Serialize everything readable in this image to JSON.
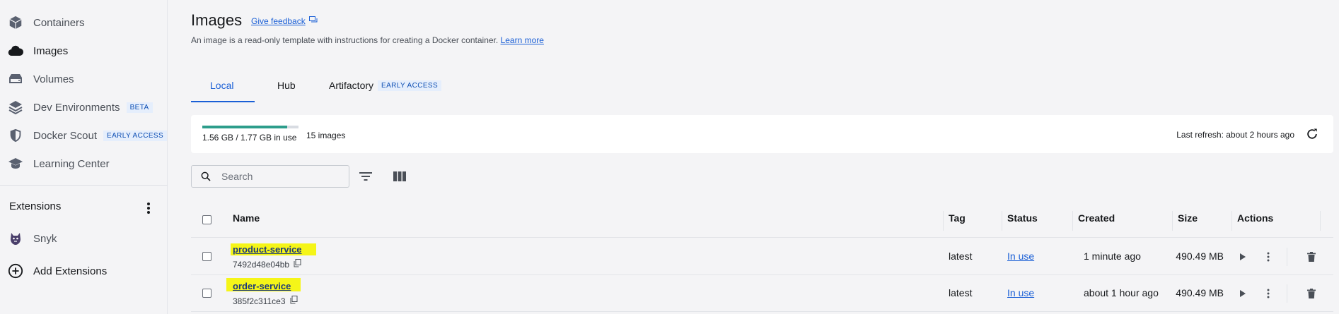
{
  "sidebar": {
    "items": [
      {
        "label": "Containers",
        "icon": "containers-icon"
      },
      {
        "label": "Images",
        "icon": "cloud-icon"
      },
      {
        "label": "Volumes",
        "icon": "volume-icon"
      },
      {
        "label": "Dev Environments",
        "icon": "dev-env-icon",
        "badge": "BETA"
      },
      {
        "label": "Docker Scout",
        "icon": "shield-icon",
        "badge": "EARLY ACCESS"
      },
      {
        "label": "Learning Center",
        "icon": "learning-icon"
      }
    ],
    "extensions_heading": "Extensions",
    "extensions": [
      {
        "label": "Snyk",
        "icon": "snyk-icon"
      },
      {
        "label": "Add Extensions",
        "icon": "add-circle-icon"
      }
    ]
  },
  "header": {
    "title": "Images",
    "feedback_link": "Give feedback",
    "subtitle": "An image is a read-only template with instructions for creating a Docker container.",
    "learn_more": "Learn more"
  },
  "tabs": [
    {
      "label": "Local",
      "active": true
    },
    {
      "label": "Hub"
    },
    {
      "label": "Artifactory",
      "badge": "EARLY ACCESS"
    }
  ],
  "usage": {
    "text": "1.56 GB / 1.77 GB in use",
    "used_fraction": 0.88,
    "count": "15 images",
    "last_refresh": "Last refresh: about 2 hours ago"
  },
  "search": {
    "placeholder": "Search",
    "value": ""
  },
  "table": {
    "columns": [
      "Name",
      "Tag",
      "Status",
      "Created",
      "Size",
      "Actions"
    ],
    "rows": [
      {
        "name": "product-service",
        "id": "7492d48e04bb",
        "tag": "latest",
        "status": "In use",
        "created": "1 minute ago",
        "size": "490.49 MB"
      },
      {
        "name": "order-service",
        "id": "385f2c311ce3",
        "tag": "latest",
        "status": "In use",
        "created": "about 1 hour ago",
        "size": "490.49 MB"
      }
    ]
  },
  "colors": {
    "accent": "#1a5fd6",
    "usage_fill": "#2d9d8b",
    "highlight": "#f5f518"
  }
}
